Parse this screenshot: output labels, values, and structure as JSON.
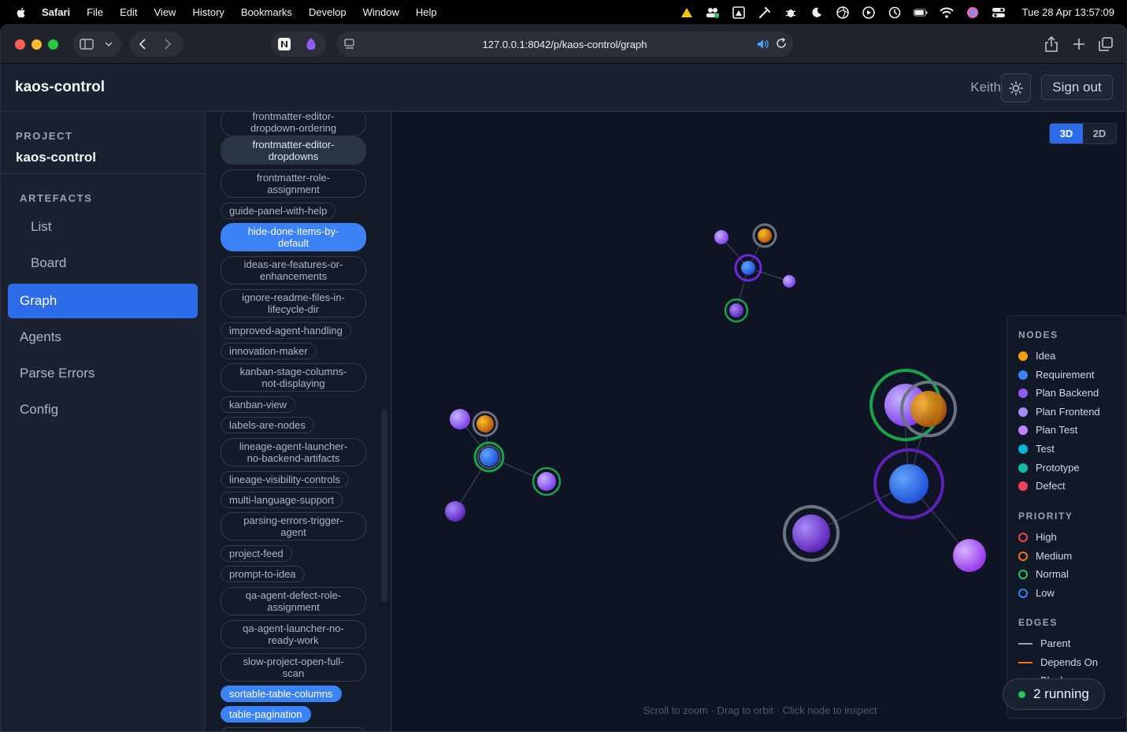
{
  "menubar": {
    "app_name": "Safari",
    "menus": [
      "File",
      "Edit",
      "View",
      "History",
      "Bookmarks",
      "Develop",
      "Window",
      "Help"
    ],
    "datetime": "Tue 28 Apr  13:57:09"
  },
  "browser": {
    "url": "127.0.0.1:8042/p/kaos-control/graph"
  },
  "header": {
    "title": "kaos-control",
    "user": "Keith",
    "signout_label": "Sign out"
  },
  "sidebar": {
    "project_label": "PROJECT",
    "project_name": "kaos-control",
    "artefacts_label": "ARTEFACTS",
    "items": [
      {
        "label": "List"
      },
      {
        "label": "Board"
      },
      {
        "label": "Graph"
      },
      {
        "label": "Agents"
      },
      {
        "label": "Parse Errors"
      },
      {
        "label": "Config"
      }
    ]
  },
  "artefacts": [
    "frontmatter-editor-dropdown-ordering",
    "frontmatter-editor-dropdowns",
    "frontmatter-role-assignment",
    "guide-panel-with-help",
    "hide-done-items-by-default",
    "ideas-are-features-or-enhancements",
    "ignore-readme-files-in-lifecycle-dir",
    "improved-agent-handling",
    "innovation-maker",
    "kanban-stage-columns-not-displaying",
    "kanban-view",
    "labels-are-nodes",
    "lineage-agent-launcher-no-backend-artifacts",
    "lineage-visibility-controls",
    "multi-language-support",
    "parsing-errors-trigger-agent",
    "project-feed",
    "prompt-to-idea",
    "qa-agent-defect-role-assignment",
    "qa-agent-launcher-no-ready-work",
    "slow-project-open-full-scan",
    "sortable-table-columns",
    "table-pagination"
  ],
  "artefact_lines": {
    "a0": [
      "frontmatter-editor-",
      "dropdown-ordering"
    ],
    "a1": [
      "frontmatter-editor-",
      "dropdowns"
    ],
    "a2": [
      "frontmatter-role-",
      "assignment"
    ],
    "a4": [
      "hide-done-items-by-",
      "default"
    ],
    "a5": [
      "ideas-are-features-or-",
      "enhancements"
    ],
    "a6": [
      "ignore-readme-files-in-",
      "lifecycle-dir"
    ],
    "a9": [
      "kanban-stage-columns-",
      "not-displaying"
    ],
    "a12": [
      "lineage-agent-launcher-",
      "no-backend-artifacts"
    ],
    "a15": [
      "parsing-errors-trigger-",
      "agent"
    ],
    "a18": [
      "qa-agent-defect-role-",
      "assignment"
    ],
    "a19": [
      "qa-agent-launcher-no-",
      "ready-work"
    ],
    "a20": [
      "slow-project-open-full-",
      "scan"
    ]
  },
  "graph": {
    "view_toggle": {
      "option_3d": "3D",
      "option_2d": "2D",
      "selected": "3D"
    },
    "hint": "Scroll to zoom · Drag to orbit · Click node to inspect",
    "running_label": "2 running"
  },
  "legend": {
    "nodes_title": "NODES",
    "nodes": [
      {
        "label": "Idea",
        "color": "#f59e0b"
      },
      {
        "label": "Requirement",
        "color": "#3b82f6"
      },
      {
        "label": "Plan Backend",
        "color": "#8b5cf6"
      },
      {
        "label": "Plan Frontend",
        "color": "#a78bfa"
      },
      {
        "label": "Plan Test",
        "color": "#c084fc"
      },
      {
        "label": "Test",
        "color": "#06b6d4"
      },
      {
        "label": "Prototype",
        "color": "#14b8a6"
      },
      {
        "label": "Defect",
        "color": "#f43f5e"
      }
    ],
    "priority_title": "PRIORITY",
    "priority": [
      {
        "label": "High",
        "color": "#ef4444"
      },
      {
        "label": "Medium",
        "color": "#f97316"
      },
      {
        "label": "Normal",
        "color": "#22c55e"
      },
      {
        "label": "Low",
        "color": "#3b82f6"
      }
    ],
    "edges_title": "EDGES",
    "edges": [
      {
        "label": "Parent",
        "color": "#9ca3af"
      },
      {
        "label": "Depends On",
        "color": "#f97316"
      },
      {
        "label": "Blocks",
        "color": "#9ca3af"
      }
    ]
  }
}
